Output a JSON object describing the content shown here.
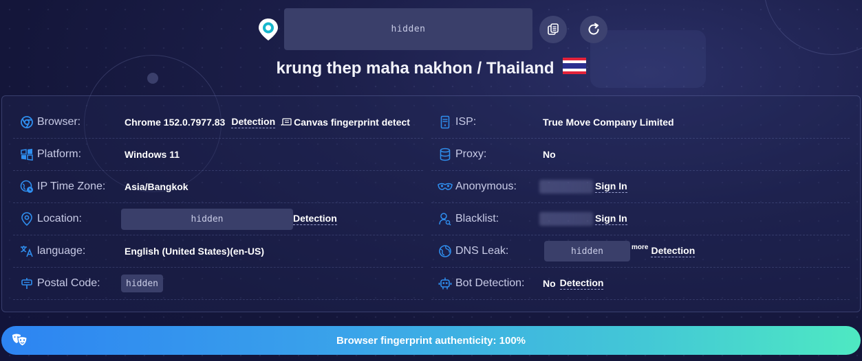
{
  "ip": {
    "value": "hidden"
  },
  "location": {
    "city": "krung thep maha nakhon",
    "separator": " / ",
    "country": "Thailand"
  },
  "rows_left": {
    "browser": {
      "label": "Browser:",
      "value": "Chrome 152.0.7977.83",
      "link": "Detection",
      "extra": "Canvas fingerprint detect"
    },
    "platform": {
      "label": "Platform:",
      "value": "Windows 11"
    },
    "timezone": {
      "label": "IP Time Zone:",
      "value": "Asia/Bangkok"
    },
    "location": {
      "label": "Location:",
      "value": "hidden",
      "link": "Detection"
    },
    "language": {
      "label": "language:",
      "value": "English (United States)(en-US)"
    },
    "postal": {
      "label": "Postal Code:",
      "value": "hidden"
    }
  },
  "rows_right": {
    "isp": {
      "label": "ISP:",
      "value": "True Move Company Limited"
    },
    "proxy": {
      "label": "Proxy:",
      "value": "No"
    },
    "anonymous": {
      "label": "Anonymous:",
      "link": "Sign In"
    },
    "blacklist": {
      "label": "Blacklist:",
      "link": "Sign In"
    },
    "dns": {
      "label": "DNS Leak:",
      "value": "hidden",
      "more": "more",
      "link": "Detection"
    },
    "bot": {
      "label": "Bot Detection:",
      "value": "No",
      "link": "Detection"
    }
  },
  "score": {
    "text": "Browser fingerprint authenticity: 100%",
    "percent": 100
  },
  "colors": {
    "accent_start": "#2d84f2",
    "accent_end": "#4ee9c2",
    "panel_bg": "#232855",
    "hidden_box": "#3a3f6a"
  }
}
